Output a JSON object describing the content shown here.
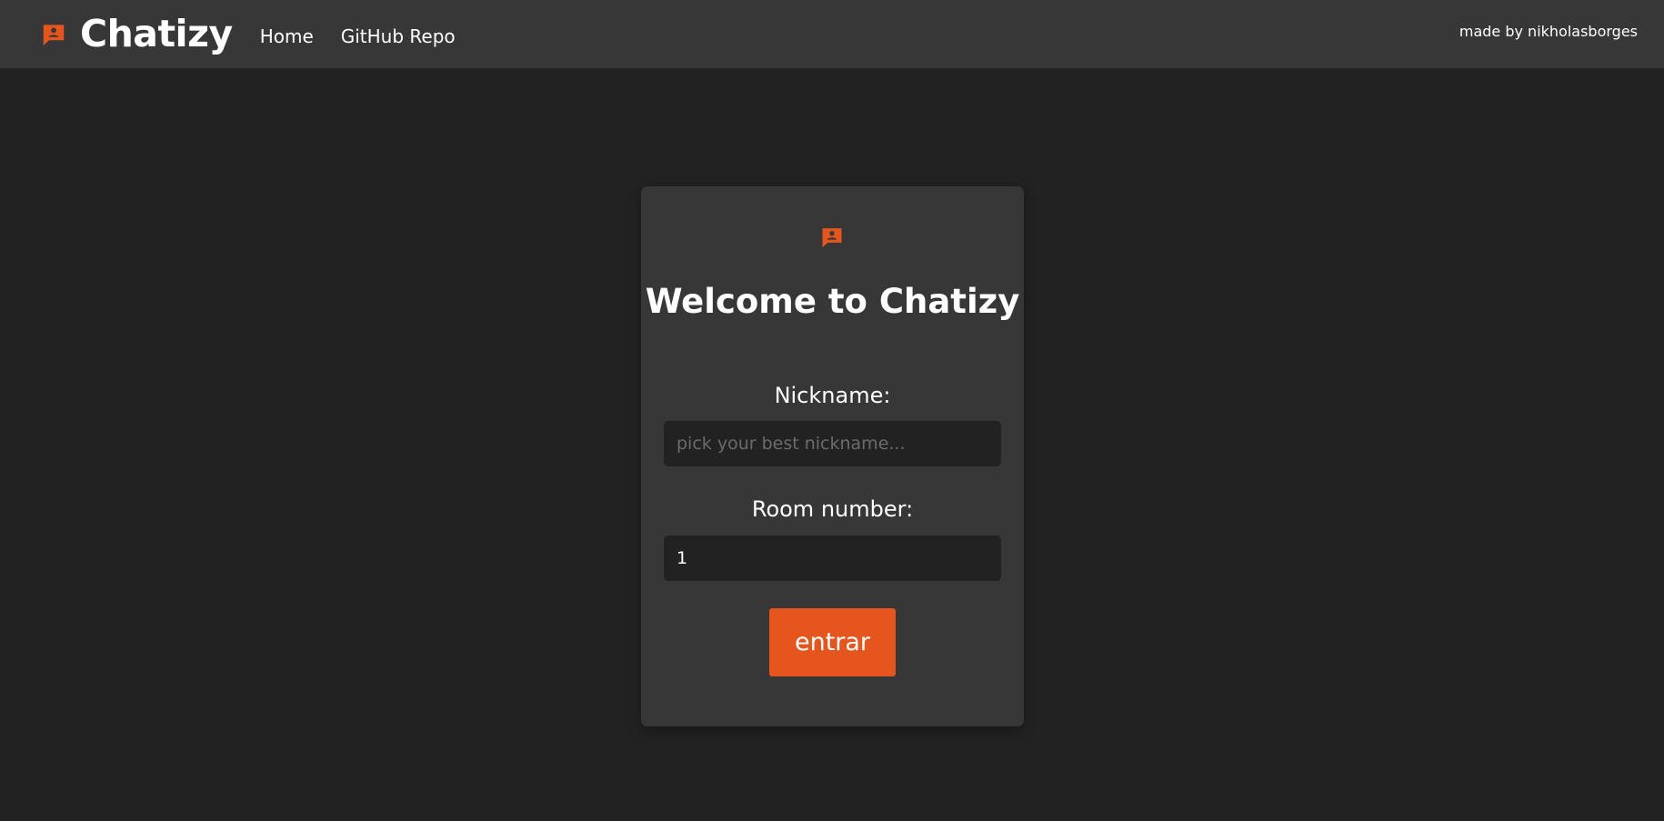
{
  "header": {
    "title": "Chatizy",
    "icon": "chat-person-icon",
    "nav": [
      {
        "label": "Home"
      },
      {
        "label": "GitHub Repo"
      }
    ],
    "credit": "made by nikholasborges"
  },
  "login": {
    "icon": "chat-person-icon",
    "title": "Welcome to Chatizy",
    "nickname_label": "Nickname:",
    "nickname_placeholder": "pick your best nickname...",
    "nickname_value": "",
    "room_label": "Room number:",
    "room_value": "1",
    "submit_label": "entrar"
  },
  "colors": {
    "accent": "#e5561f",
    "background": "#222222",
    "surface": "#373737",
    "text": "#ffffff"
  }
}
